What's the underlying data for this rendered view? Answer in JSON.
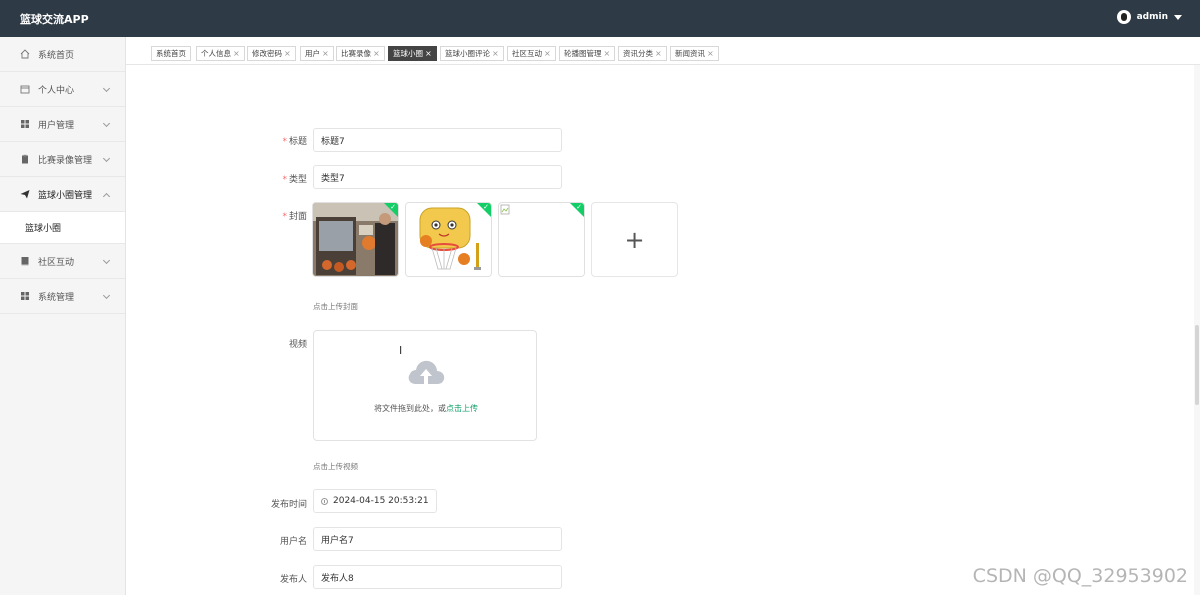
{
  "header": {
    "app_title": "篮球交流APP",
    "username": "admin"
  },
  "sidebar": {
    "items": [
      {
        "label": "系统首页",
        "icon": "home-icon"
      },
      {
        "label": "个人中心",
        "icon": "calendar-icon"
      },
      {
        "label": "用户管理",
        "icon": "grid-icon"
      },
      {
        "label": "比赛录像管理",
        "icon": "clipboard-icon"
      },
      {
        "label": "篮球小圈管理",
        "icon": "send-icon"
      },
      {
        "label": "篮球小圈"
      },
      {
        "label": "社区互动",
        "icon": "book-icon"
      },
      {
        "label": "系统管理",
        "icon": "grid-icon"
      }
    ]
  },
  "tabs": [
    {
      "label": "系统首页"
    },
    {
      "label": "个人信息"
    },
    {
      "label": "修改密码"
    },
    {
      "label": "用户"
    },
    {
      "label": "比赛录像"
    },
    {
      "label": "篮球小圈"
    },
    {
      "label": "篮球小圈评论"
    },
    {
      "label": "社区互动"
    },
    {
      "label": "轮播图管理"
    },
    {
      "label": "资讯分类"
    },
    {
      "label": "新闻资讯"
    }
  ],
  "tab_close": "×",
  "form": {
    "title_label": "标题",
    "title_value": "标题7",
    "type_label": "类型",
    "type_value": "类型7",
    "cover_label": "封面",
    "cover_hint": "点击上传封面",
    "add_symbol": "+",
    "video_label": "视频",
    "upload_text": "将文件拖到此处，或",
    "upload_link": "点击上传",
    "video_hint": "点击上传视频",
    "publish_time_label": "发布时间",
    "publish_time_value": "2024-04-15 20:53:21",
    "username_label": "用户名",
    "username_value": "用户名7",
    "publisher_label": "发布人",
    "publisher_value": "发布人8"
  },
  "required_mark": "*",
  "watermark": "CSDN @QQ_32953902",
  "colors": {
    "header_bg": "#2e3a45",
    "success_corner": "#13ce66",
    "required": "#f56c6c",
    "link": "#13a06c"
  }
}
